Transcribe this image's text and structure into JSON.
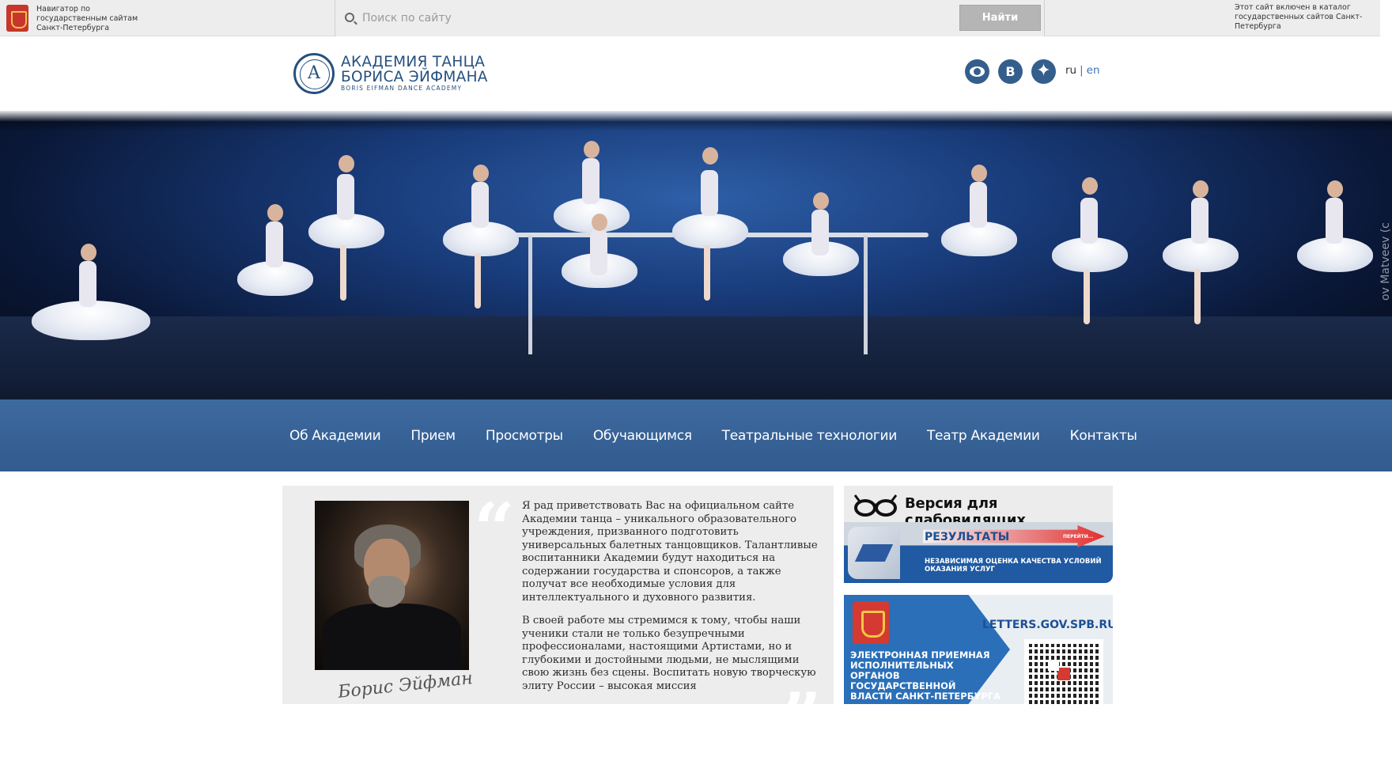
{
  "govbar": {
    "left_text": "Навигатор по государственным сайтам Санкт-Петербурга",
    "search_placeholder": "Поиск по сайту",
    "search_button": "Найти",
    "right_text": "Этот сайт включен в каталог государственных сайтов Санкт-Петербурга"
  },
  "header": {
    "logo_line1": "АКАДЕМИЯ ТАНЦА",
    "logo_line2": "БОРИСА ЭЙФМАНА",
    "logo_line3": "BORIS EIFMAN DANCE ACADEMY",
    "logo_mark": "A",
    "vk_label": "В",
    "lang_ru": "ru",
    "lang_sep": "|",
    "lang_en": "en",
    "icons": [
      "eye-icon",
      "vk-icon",
      "compass-star-icon"
    ]
  },
  "hero": {
    "photo_credit": "ov Matveev (c"
  },
  "nav": {
    "items": [
      "Об Академии",
      "Прием",
      "Просмотры",
      "Обучающимся",
      "Театральные технологии",
      "Театр Академии",
      "Контакты"
    ]
  },
  "welcome": {
    "quote_open": "“",
    "quote_close": "”",
    "paragraph1": "Я рад приветствовать Вас на официальном сайте Академии танца – уникального образовательного учреждения, призванного подготовить универсальных балетных танцовщиков. Талантливые воспитанники Академии будут находиться на  содержании государства и спонсоров, а также получат все необходимые условия для интеллектуального и духовного развития.",
    "paragraph2": "В своей работе мы стремимся к тому, чтобы наши ученики стали не только безупречными профессионалами, настоящими Артистами, но и глубокими и достойными людьми, не мыслящими свою жизнь без сцены. Воспитать новую творческую элиту России – высокая миссия",
    "signature": "Борис Эйфман"
  },
  "banners": {
    "vision_title": "Версия для слабовидящих",
    "results_title": "РЕЗУЛЬТАТЫ",
    "results_go": "ПЕРЕЙТИ...",
    "results_sub": "НЕЗАВИСИМАЯ ОЦЕНКА КАЧЕСТВА УСЛОВИЙ ОКАЗАНИЯ УСЛУГ",
    "letters_url": "LETTERS.GOV.SPB.RU",
    "letters_text": "ЭЛЕКТРОННАЯ ПРИЕМНАЯ ИСПОЛНИТЕЛЬНЫХ ОРГАНОВ ГОСУДАРСТВЕННОЙ ВЛАСТИ САНКТ-ПЕТЕРБУРГА"
  },
  "colors": {
    "nav_bg": "#3d6aa0",
    "brand_blue": "#25507e",
    "link_blue": "#3c72b5",
    "welcome_bg": "#ededed"
  }
}
